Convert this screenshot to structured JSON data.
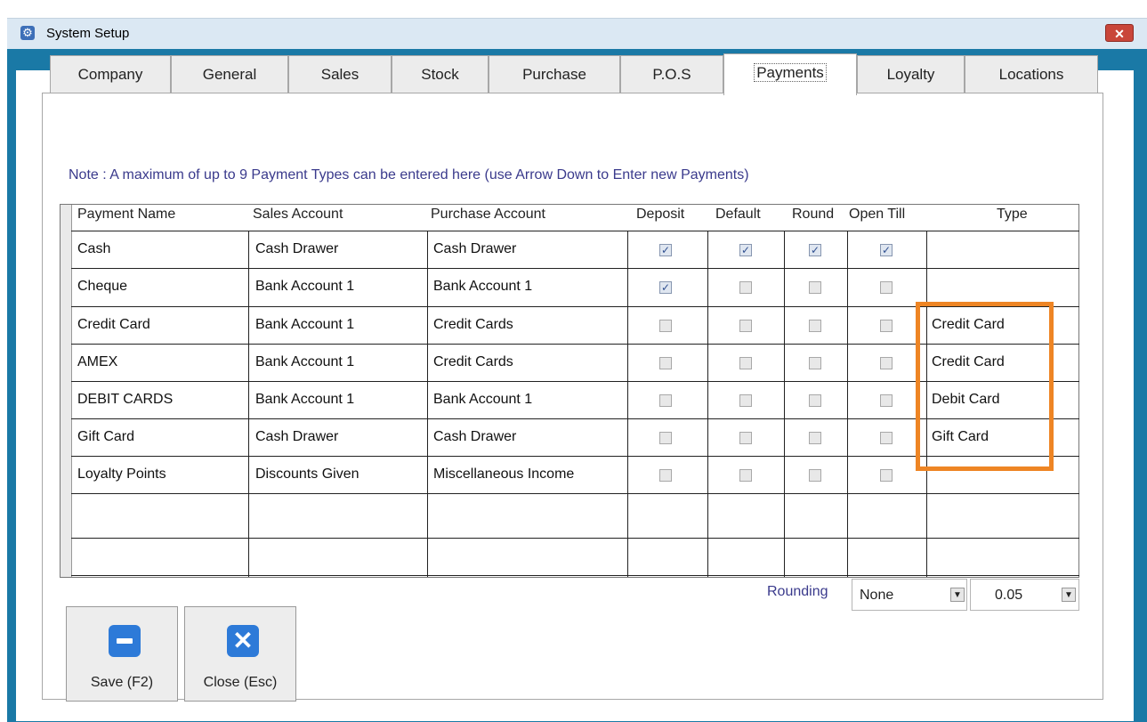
{
  "window": {
    "title": "System Setup",
    "close_glyph": "✕",
    "app_icon": "gear-icon"
  },
  "tabs": [
    "Company",
    "General",
    "Sales",
    "Stock",
    "Purchase",
    "P.O.S",
    "Payments",
    "Loyalty",
    "Locations"
  ],
  "active_tab": "Payments",
  "note": "Note : A maximum of up to 9 Payment Types can be entered here (use Arrow Down to Enter new Payments)",
  "grid": {
    "headers": [
      "Payment Name",
      "Sales Account",
      "Purchase Account",
      "Deposit",
      "Default",
      "Round",
      "Open Till",
      "Type"
    ],
    "rows": [
      {
        "name": "Cash",
        "sales": "Cash Drawer",
        "purchase": "Cash Drawer",
        "deposit": true,
        "default": true,
        "round": true,
        "open_till": true,
        "type": ""
      },
      {
        "name": "Cheque",
        "sales": "Bank Account  1",
        "purchase": "Bank Account  1",
        "deposit": true,
        "default": false,
        "round": false,
        "open_till": false,
        "type": ""
      },
      {
        "name": "Credit Card",
        "sales": "Bank Account  1",
        "purchase": "Credit Cards",
        "deposit": false,
        "default": false,
        "round": false,
        "open_till": false,
        "type": "Credit Card"
      },
      {
        "name": "AMEX",
        "sales": "Bank Account  1",
        "purchase": "Credit Cards",
        "deposit": false,
        "default": false,
        "round": false,
        "open_till": false,
        "type": "Credit Card"
      },
      {
        "name": "DEBIT CARDS",
        "sales": "Bank Account  1",
        "purchase": "Bank Account  1",
        "deposit": false,
        "default": false,
        "round": false,
        "open_till": false,
        "type": "Debit Card"
      },
      {
        "name": "Gift Card",
        "sales": "Cash Drawer",
        "purchase": "Cash Drawer",
        "deposit": false,
        "default": false,
        "round": false,
        "open_till": false,
        "type": "Gift Card"
      },
      {
        "name": "Loyalty Points",
        "sales": "Discounts Given",
        "purchase": "Miscellaneous Income",
        "deposit": false,
        "default": false,
        "round": false,
        "open_till": false,
        "type": ""
      }
    ],
    "empty_rows": 2
  },
  "rounding": {
    "label": "Rounding",
    "mode": "None",
    "amount": "0.05"
  },
  "buttons": {
    "save": "Save (F2)",
    "close": "Close (Esc)"
  },
  "colors": {
    "frame": "#1a79a6",
    "highlight": "#ee8524",
    "accent_text": "#3a3a8c",
    "button_icon": "#2d7ad8"
  }
}
